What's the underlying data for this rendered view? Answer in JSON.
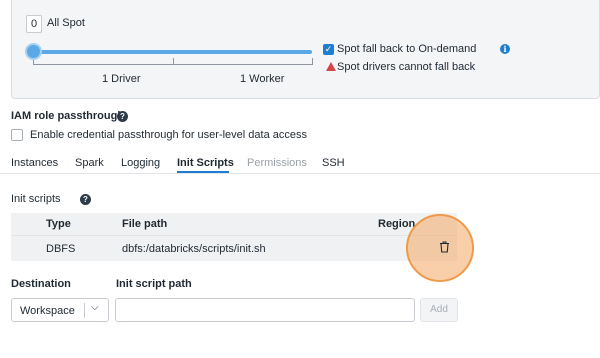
{
  "spot": {
    "count": "0",
    "label": "All Spot",
    "scale_left": "1 Driver",
    "scale_right": "1 Worker",
    "fallback_label": "Spot fall back to On-demand",
    "fallback_checked": true,
    "warning": "Spot drivers cannot fall back",
    "slider_value": 0
  },
  "iam": {
    "title": "IAM role passthrough",
    "checkbox_label": "Enable credential passthrough for user-level data access"
  },
  "tabs": [
    {
      "label": "Instances",
      "state": "normal"
    },
    {
      "label": "Spark",
      "state": "normal"
    },
    {
      "label": "Logging",
      "state": "normal"
    },
    {
      "label": "Init Scripts",
      "state": "active"
    },
    {
      "label": "Permissions",
      "state": "disabled"
    },
    {
      "label": "SSH",
      "state": "normal"
    }
  ],
  "init_scripts": {
    "title": "Init scripts",
    "columns": [
      "Type",
      "File path",
      "Region"
    ],
    "rows": [
      {
        "type": "DBFS",
        "path": "dbfs:/databricks/scripts/init.sh",
        "region": ""
      }
    ]
  },
  "form": {
    "destination_label": "Destination",
    "path_label": "Init script path",
    "destination_value": "Workspace",
    "path_placeholder": "",
    "add_label": "Add"
  },
  "colors": {
    "accent": "#1f7ed0",
    "slider": "#5aa9e6",
    "warning": "#d64545",
    "highlight": "#ef9a4a"
  },
  "icons": {
    "info": "info-icon",
    "help": "help-icon",
    "warning": "warning-icon",
    "delete": "trash-icon",
    "chevron": "chevron-down-icon"
  }
}
